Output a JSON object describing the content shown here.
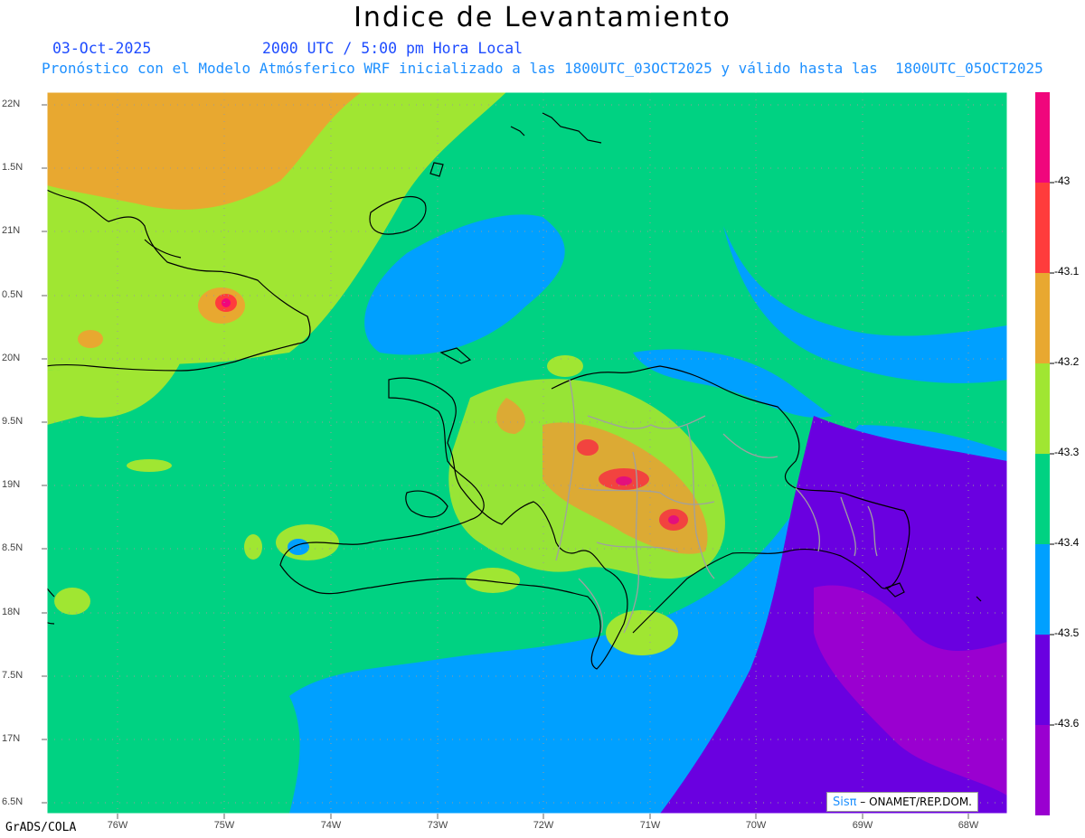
{
  "title": "Indice de Levantamiento",
  "date": "03-Oct-2025",
  "time": "2000 UTC / 5:00 pm Hora Local",
  "description": "Pronóstico con el Modelo Atmósferico WRF inicializado a las 1800UTC_03OCT2025 y válido hasta las  1800UTC_05OCT2025",
  "y_labels": [
    "22N",
    "1.5N",
    "21N",
    "0.5N",
    "20N",
    "9.5N",
    "19N",
    "8.5N",
    "18N",
    "7.5N",
    "17N",
    "6.5N"
  ],
  "x_labels": [
    "76W",
    "75W",
    "74W",
    "73W",
    "72W",
    "71W",
    "70W",
    "69W",
    "68W"
  ],
  "footer": {
    "grads": "GrADS/COLA",
    "credit_brand": "Sisπ",
    "credit_text": " – ONAMET/REP.DOM."
  },
  "colorbar": {
    "labels": [
      "-43",
      "-43.1",
      "-43.2",
      "-43.3",
      "-43.4",
      "-43.5",
      "-43.6"
    ],
    "colors": [
      "#f0067c",
      "#ff3c3c",
      "#e8a830",
      "#a0e632",
      "#00d282",
      "#00a0ff",
      "#6a00e0",
      "#9a00d0"
    ]
  },
  "colors": {
    "sea_green": "#00d282",
    "sea_blue": "#00a0ff",
    "violet": "#6a00e0",
    "purple": "#9a00d0",
    "lime": "#a0e632",
    "orange": "#e8a830",
    "red": "#ff3c3c",
    "magenta": "#f0067c",
    "coast": "#000000",
    "provinces": "#a0a0a0"
  }
}
